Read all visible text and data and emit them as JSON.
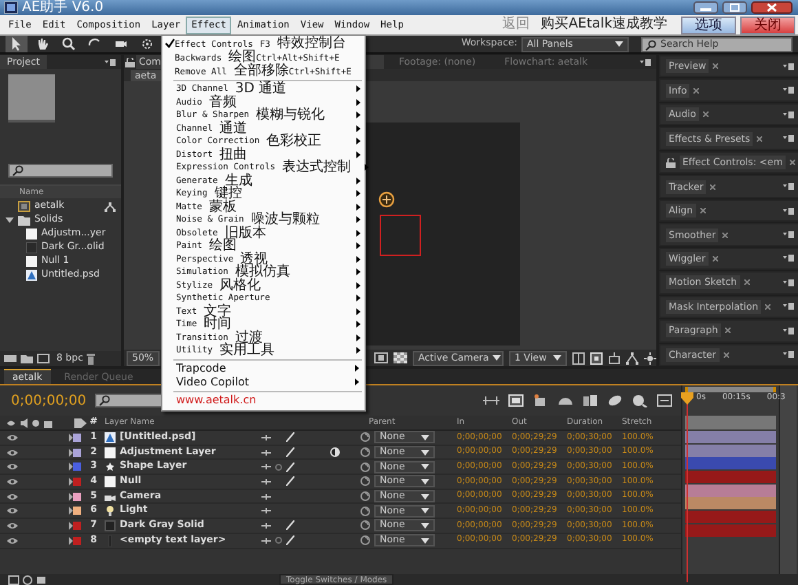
{
  "window": {
    "title": "AE助手 V6.0"
  },
  "menu_bar": {
    "items": [
      {
        "label": "File",
        "selected": false
      },
      {
        "label": "Edit",
        "selected": false
      },
      {
        "label": "Composition",
        "selected": false
      },
      {
        "label": "Layer",
        "selected": false
      },
      {
        "label": "Effect",
        "selected": true
      },
      {
        "label": "Animation",
        "selected": false
      },
      {
        "label": "View",
        "selected": false
      },
      {
        "label": "Window",
        "selected": false
      },
      {
        "label": "Help",
        "selected": false
      }
    ],
    "links": [
      "返回",
      "购买AEtalk速成教学"
    ],
    "buttons": [
      {
        "label": "选项",
        "kind": "options"
      },
      {
        "label": "关闭",
        "kind": "close"
      }
    ]
  },
  "toolbar": {
    "workspace_label": "Workspace:",
    "workspace": "All Panels",
    "search_placeholder": "Search Help"
  },
  "project_panel": {
    "tab": "Project",
    "column": "Name",
    "bit_depth": "8 bpc",
    "items": [
      {
        "name": "aetalk",
        "kind": "comp"
      },
      {
        "name": "Solids",
        "kind": "folder",
        "expanded": true,
        "children": [
          {
            "name": "Adjustm...yer",
            "kind": "white"
          },
          {
            "name": "Dark Gr...olid",
            "kind": "dark"
          },
          {
            "name": "Null 1",
            "kind": "white"
          },
          {
            "name": "Untitled.psd",
            "kind": "psd"
          }
        ]
      }
    ]
  },
  "comp_panel": {
    "tabs": [
      {
        "label": "Com",
        "selected": true
      },
      {
        "label": "Footage: (none)",
        "selected": false
      },
      {
        "label": "Flowchart: aetalk",
        "selected": false
      }
    ],
    "subtab": "aeta",
    "zoom": "50%",
    "camera": "Active Camera",
    "views": "1 View"
  },
  "side_panels": [
    {
      "label": "Preview"
    },
    {
      "label": "Info"
    },
    {
      "label": "Audio"
    },
    {
      "label": "Effects & Presets"
    },
    {
      "label": "Effect Controls: <em",
      "locked": true
    },
    {
      "label": "Tracker"
    },
    {
      "label": "Align"
    },
    {
      "label": "Smoother"
    },
    {
      "label": "Wiggler"
    },
    {
      "label": "Motion Sketch"
    },
    {
      "label": "Mask Interpolation"
    },
    {
      "label": "Paragraph"
    },
    {
      "label": "Character"
    }
  ],
  "timeline": {
    "tabs": [
      {
        "label": "aetalk",
        "selected": true
      },
      {
        "label": "Render Queue",
        "selected": false
      }
    ],
    "time": "0;00;00;00",
    "columns": [
      "#",
      "Layer Name",
      "Parent",
      "In",
      "Out",
      "Duration",
      "Stretch"
    ],
    "ruler": [
      "0s",
      "00:15s",
      "00:3"
    ],
    "layers": [
      {
        "number": "1",
        "name": "[Untitled.psd]",
        "kind": "footage",
        "color": "#aaa3d8",
        "parent": "None",
        "in": "0;00;00;00",
        "out": "0;00;29;29",
        "duration": "0;00;30;00",
        "stretch": "100.0%"
      },
      {
        "number": "2",
        "name": "Adjustment Layer",
        "kind": "adjustment",
        "color": "#aaa3d8",
        "parent": "None",
        "in": "0;00;00;00",
        "out": "0;00;29;29",
        "duration": "0;00;30;00",
        "stretch": "100.0%"
      },
      {
        "number": "3",
        "name": "Shape Layer",
        "kind": "shape",
        "color": "#4a5fe0",
        "parent": "None",
        "in": "0;00;00;00",
        "out": "0;00;29;29",
        "duration": "0;00;30;00",
        "stretch": "100.0%"
      },
      {
        "number": "4",
        "name": "Null",
        "kind": "null",
        "color": "#c02020",
        "parent": "None",
        "in": "0;00;00;00",
        "out": "0;00;29;29",
        "duration": "0;00;30;00",
        "stretch": "100.0%"
      },
      {
        "number": "5",
        "name": "Camera",
        "kind": "camera",
        "color": "#eaa0c0",
        "parent": "None",
        "in": "0;00;00;00",
        "out": "0;00;29;29",
        "duration": "0;00;30;00",
        "stretch": "100.0%"
      },
      {
        "number": "6",
        "name": "Light",
        "kind": "light",
        "color": "#f0b080",
        "parent": "None",
        "in": "0;00;00;00",
        "out": "0;00;29;29",
        "duration": "0;00;30;00",
        "stretch": "100.0%"
      },
      {
        "number": "7",
        "name": "Dark Gray Solid",
        "kind": "solid",
        "color": "#c02020",
        "parent": "None",
        "in": "0;00;00;00",
        "out": "0;00;29;29",
        "duration": "0;00;30;00",
        "stretch": "100.0%"
      },
      {
        "number": "8",
        "name": "<empty text layer>",
        "kind": "text",
        "color": "#c02020",
        "parent": "None",
        "in": "0;00;00;00",
        "out": "0;00;29;29",
        "duration": "0;00;30;00",
        "stretch": "100.0%"
      }
    ],
    "toggle": "Toggle Switches / Modes"
  },
  "effect_menu": {
    "sections": [
      {
        "kind": "commands",
        "items": [
          {
            "label": "Effect Controls",
            "checked": true,
            "parts": [
              "F3",
              "特效控制台"
            ]
          },
          {
            "label": "Backwards",
            "checked": false,
            "parts": [
              "绘图",
              "Ctrl+Alt+Shift+E"
            ]
          },
          {
            "label": "Remove All",
            "checked": false,
            "parts": [
              "全部移除",
              "Ctrl+Shift+E"
            ]
          }
        ]
      },
      {
        "kind": "categories",
        "items": [
          {
            "label": "3D Channel",
            "note": "3D 通道"
          },
          {
            "label": "Audio",
            "note": "音频"
          },
          {
            "label": "Blur & Sharpen",
            "note": "模糊与锐化"
          },
          {
            "label": "Channel",
            "note": "通道"
          },
          {
            "label": "Color Correction",
            "note": "色彩校正"
          },
          {
            "label": "Distort",
            "note": "扭曲"
          },
          {
            "label": "Expression Controls",
            "note": "表达式控制"
          },
          {
            "label": "Generate",
            "note": "生成"
          },
          {
            "label": "Keying",
            "note": "键控"
          },
          {
            "label": "Matte",
            "note": "蒙板"
          },
          {
            "label": "Noise & Grain",
            "note": "噪波与颗粒"
          },
          {
            "label": "Obsolete",
            "note": "旧版本"
          },
          {
            "label": "Paint",
            "note": "绘图"
          },
          {
            "label": "Perspective",
            "note": "透视"
          },
          {
            "label": "Simulation",
            "note": "模拟仿真"
          },
          {
            "label": "Stylize",
            "note": "风格化"
          },
          {
            "label": "Synthetic Aperture"
          },
          {
            "label": "Text",
            "note": "文字"
          },
          {
            "label": "Time",
            "note": "时间"
          },
          {
            "label": "Transition",
            "note": "过渡"
          },
          {
            "label": "Utility",
            "note": "实用工具"
          }
        ]
      },
      {
        "kind": "plugins",
        "items": [
          {
            "label": "Trapcode"
          },
          {
            "label": "Video Copilot"
          }
        ]
      },
      {
        "kind": "link",
        "items": [
          {
            "label": "www.aetalk.cn"
          }
        ]
      }
    ]
  }
}
